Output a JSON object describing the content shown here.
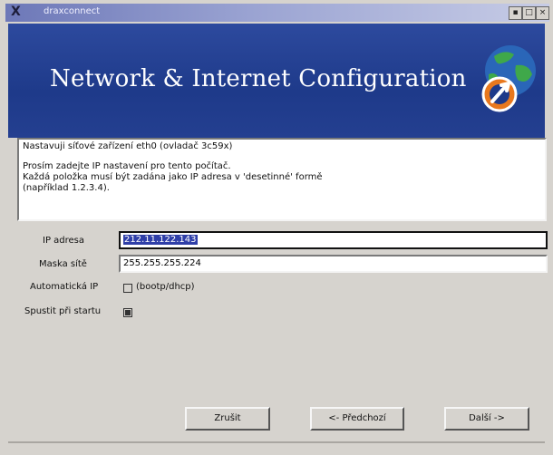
{
  "window": {
    "title": "draxconnect",
    "icon_glyph": "X",
    "controls": [
      "▪",
      "□",
      "×"
    ]
  },
  "banner": {
    "title": "Network & Internet Configuration"
  },
  "info": {
    "line1": "Nastavuji síťové zařízení eth0 (ovladač 3c59x)",
    "line2": "Prosím zadejte IP nastavení pro tento počítač.",
    "line3": "Každá položka musí být zadána jako IP adresa v 'desetinné' formě",
    "line4": "(například 1.2.3.4)."
  },
  "form": {
    "ip_label": "IP adresa",
    "ip_value": "212.11.122.143",
    "mask_label": "Maska sítě",
    "mask_value": "255.255.255.224",
    "auto_ip_label": "Automatická IP",
    "auto_ip_option": "(bootp/dhcp)",
    "auto_ip_checked": false,
    "start_on_boot_label": "Spustit při startu",
    "start_on_boot_checked": true
  },
  "buttons": {
    "cancel": "Zrušit",
    "back": "<- Předchozí",
    "next": "Další ->"
  }
}
